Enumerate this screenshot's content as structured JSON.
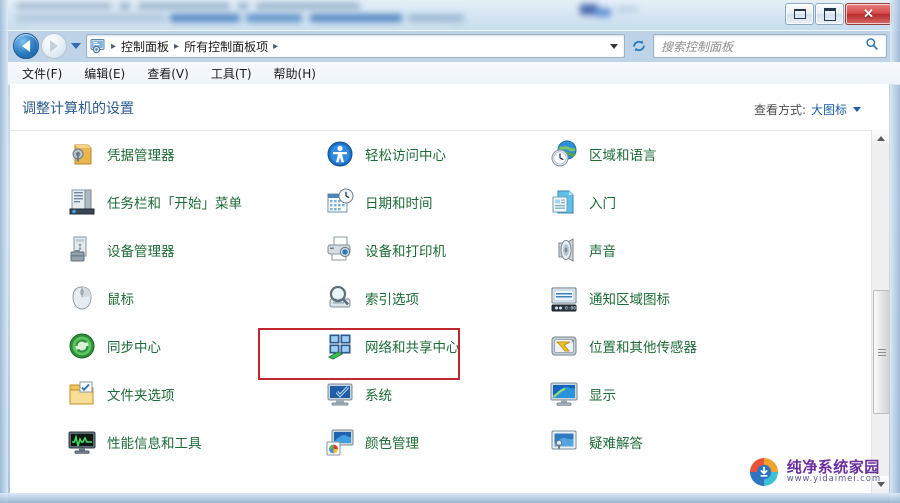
{
  "window": {
    "minimize_label": "─",
    "maximize_label": "□",
    "close_label": "✕"
  },
  "address_bar": {
    "back_tooltip": "后退",
    "forward_tooltip": "前进",
    "breadcrumbs": [
      "控制面板",
      "所有控制面板项"
    ],
    "separator": "▸",
    "refresh_icon": "↻",
    "search": {
      "placeholder": "搜索控制面板",
      "value": "",
      "icon": "⌕"
    }
  },
  "menu": {
    "items": [
      "文件(F)",
      "编辑(E)",
      "查看(V)",
      "工具(T)",
      "帮助(H)"
    ]
  },
  "content": {
    "page_title": "调整计算机的设置",
    "view_by": {
      "label": "查看方式:",
      "value": "大图标"
    }
  },
  "items": {
    "rows": [
      [
        {
          "label": "凭据管理器",
          "icon": "credential-manager-icon"
        },
        {
          "label": "轻松访问中心",
          "icon": "ease-of-access-icon"
        },
        {
          "label": "区域和语言",
          "icon": "region-language-icon"
        }
      ],
      [
        {
          "label": "任务栏和「开始」菜单",
          "icon": "taskbar-start-menu-icon"
        },
        {
          "label": "日期和时间",
          "icon": "date-time-icon"
        },
        {
          "label": "入门",
          "icon": "getting-started-icon"
        }
      ],
      [
        {
          "label": "设备管理器",
          "icon": "device-manager-icon"
        },
        {
          "label": "设备和打印机",
          "icon": "devices-printers-icon"
        },
        {
          "label": "声音",
          "icon": "sound-icon"
        }
      ],
      [
        {
          "label": "鼠标",
          "icon": "mouse-icon"
        },
        {
          "label": "索引选项",
          "icon": "indexing-options-icon"
        },
        {
          "label": "通知区域图标",
          "icon": "notification-area-icons-icon"
        }
      ],
      [
        {
          "label": "同步中心",
          "icon": "sync-center-icon"
        },
        {
          "label": "网络和共享中心",
          "icon": "network-sharing-center-icon"
        },
        {
          "label": "位置和其他传感器",
          "icon": "location-sensors-icon"
        }
      ],
      [
        {
          "label": "文件夹选项",
          "icon": "folder-options-icon"
        },
        {
          "label": "系统",
          "icon": "system-icon"
        },
        {
          "label": "显示",
          "icon": "display-icon"
        }
      ],
      [
        {
          "label": "性能信息和工具",
          "icon": "performance-info-icon"
        },
        {
          "label": "颜色管理",
          "icon": "color-management-icon"
        },
        {
          "label": "疑难解答",
          "icon": "troubleshooting-icon"
        }
      ]
    ],
    "highlighted": "网络和共享中心",
    "highlight_color": "#c0272d"
  },
  "scrollbar": {
    "up_arrow": "▲",
    "down_arrow": "▼"
  },
  "watermark": {
    "title": "纯净系统家园",
    "url": "www.yidaimei.com"
  }
}
